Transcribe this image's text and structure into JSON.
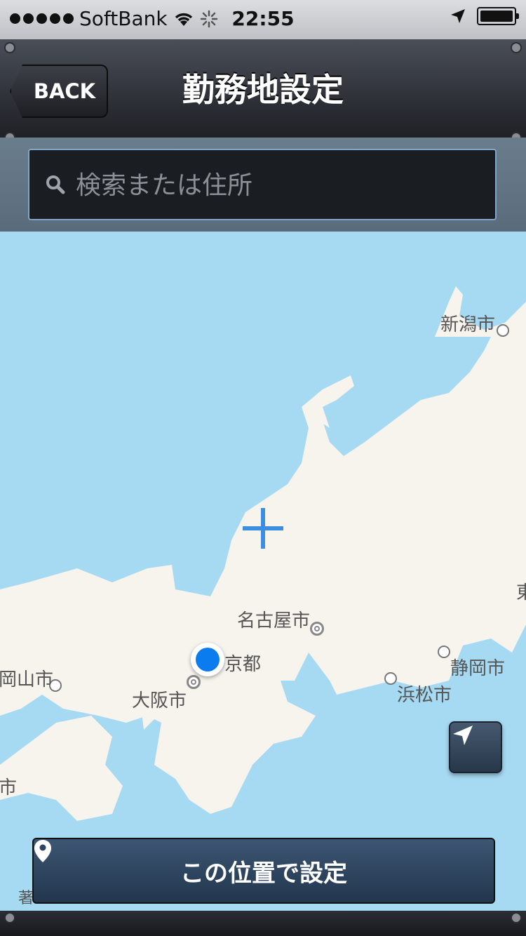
{
  "status_bar": {
    "carrier": "SoftBank",
    "time": "22:55",
    "signal_bars": 5
  },
  "nav": {
    "back_label": "BACK",
    "title": "勤務地設定"
  },
  "search": {
    "placeholder": "検索または住所",
    "value": ""
  },
  "map": {
    "cities": [
      {
        "name": "新潟市"
      },
      {
        "name": "名古屋市"
      },
      {
        "name": "京都"
      },
      {
        "name": "大阪市"
      },
      {
        "name": "静岡市"
      },
      {
        "name": "浜松市"
      },
      {
        "name": "岡山市"
      },
      {
        "name": "東"
      },
      {
        "name": "市"
      }
    ],
    "attribution": "著"
  },
  "actions": {
    "set_location_label": "この位置で設定"
  },
  "colors": {
    "water": "#a6d9f2",
    "land": "#f7f4ee",
    "user_location": "#0a7cf0",
    "crosshair": "#3c8fe0"
  }
}
